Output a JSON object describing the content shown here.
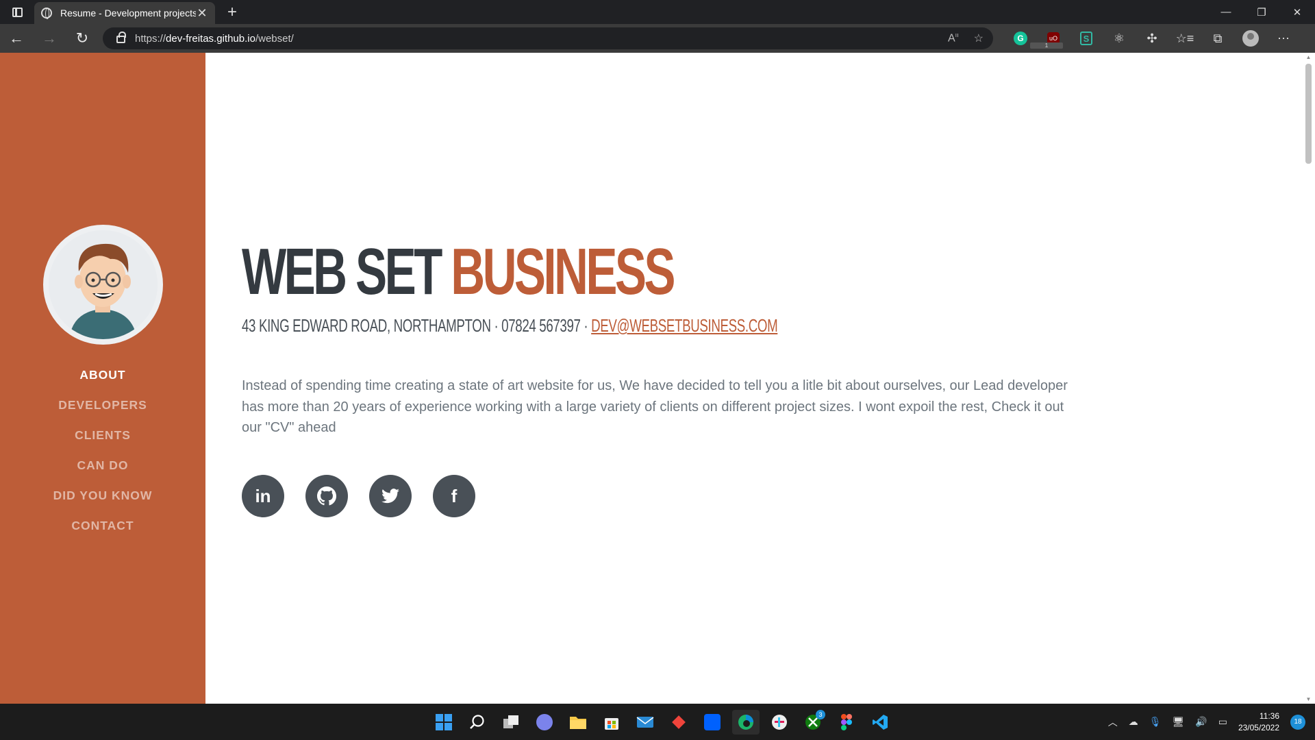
{
  "browser": {
    "tab_title": "Resume - Development projects",
    "url_scheme": "https://",
    "url_host": "dev-freitas.github.io",
    "url_path": "/webset/"
  },
  "sidebar": {
    "nav": [
      {
        "label": "ABOUT",
        "active": true
      },
      {
        "label": "DEVELOPERS",
        "active": false
      },
      {
        "label": "CLIENTS",
        "active": false
      },
      {
        "label": "CAN DO",
        "active": false
      },
      {
        "label": "DID YOU KNOW",
        "active": false
      },
      {
        "label": "CONTACT",
        "active": false
      }
    ]
  },
  "hero": {
    "title_part1": "WEB SET",
    "title_part2": "BUSINESS",
    "address": "43 KING EDWARD ROAD, NORTHAMPTON · 07824 567397 · ",
    "email": "DEV@WEBSETBUSINESS.COM",
    "lead": "Instead of spending time creating a state of art website for us, We have decided to tell you a litle bit about ourselves, our Lead developer has more than 20 years of experience working with a large variety of clients on different project sizes. I wont expoil the rest, Check it out our \"CV\" ahead"
  },
  "socials": [
    {
      "icon": "linkedin-icon",
      "glyph": "in"
    },
    {
      "icon": "github-icon",
      "glyph": ""
    },
    {
      "icon": "twitter-icon",
      "glyph": ""
    },
    {
      "icon": "facebook-icon",
      "glyph": "f"
    }
  ],
  "extensions": {
    "ublock_badge": "1"
  },
  "taskbar": {
    "xbox_badge": "3",
    "time": "11:36",
    "date": "23/05/2022",
    "notification_count": "18"
  },
  "colors": {
    "accent": "#bd5d38",
    "dark": "#343a40",
    "social_bg": "#495057"
  }
}
